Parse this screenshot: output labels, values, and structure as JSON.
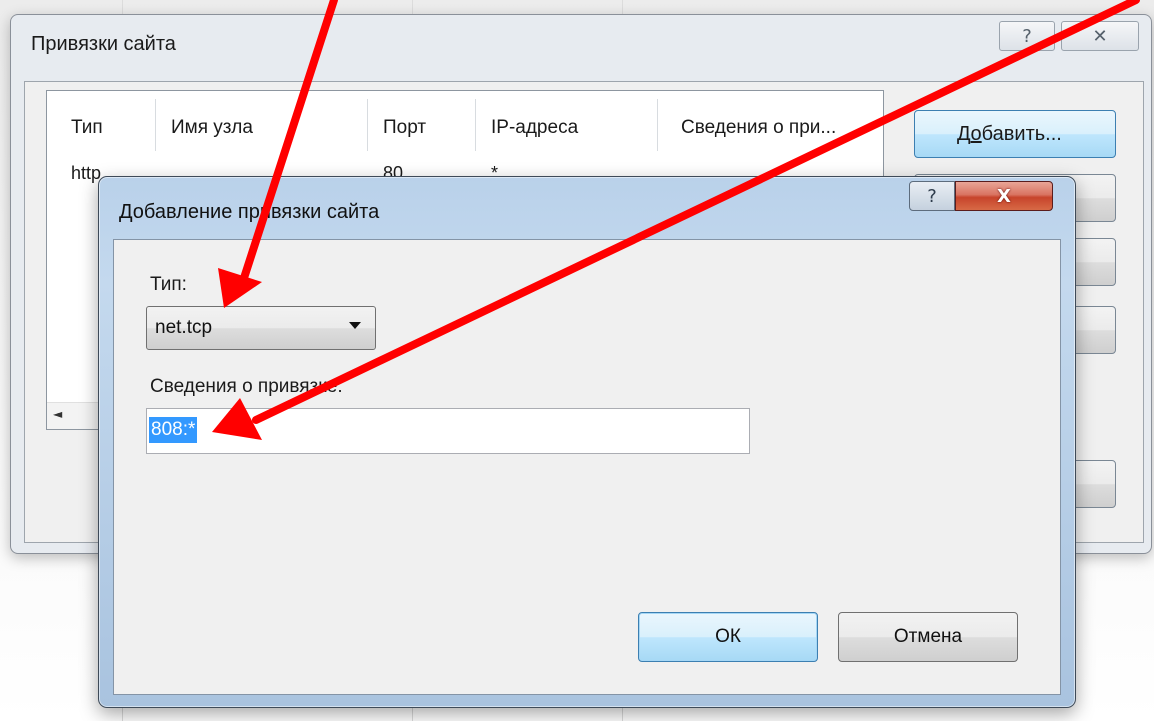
{
  "outer_dialog": {
    "title": "Привязки сайта",
    "help_glyph": "?",
    "close_glyph": "✕",
    "table": {
      "columns": [
        "Тип",
        "Имя узла",
        "Порт",
        "IP-адреса",
        "Сведения о при..."
      ],
      "rows": [
        [
          "http",
          "",
          "80",
          "*",
          ""
        ]
      ]
    },
    "buttons": {
      "add_prefix": "Д",
      "add_underlined": "о",
      "add_suffix": "бавить..."
    }
  },
  "inner_dialog": {
    "title": "Добавление привязки сайта",
    "help_glyph": "?",
    "close_glyph": "X",
    "type_label": "Тип:",
    "type_value": "net.tcp",
    "binding_label": "Сведения о привязке:",
    "binding_value": "808:*",
    "ok_label": "ОК",
    "cancel_label": "Отмена"
  },
  "colors": {
    "arrow": "#ff0000",
    "selection": "#3399ff",
    "close_button": "#c7442b"
  },
  "icons": [
    "dropdown-arrow-icon",
    "scroll-left-icon",
    "help-icon",
    "close-icon"
  ]
}
